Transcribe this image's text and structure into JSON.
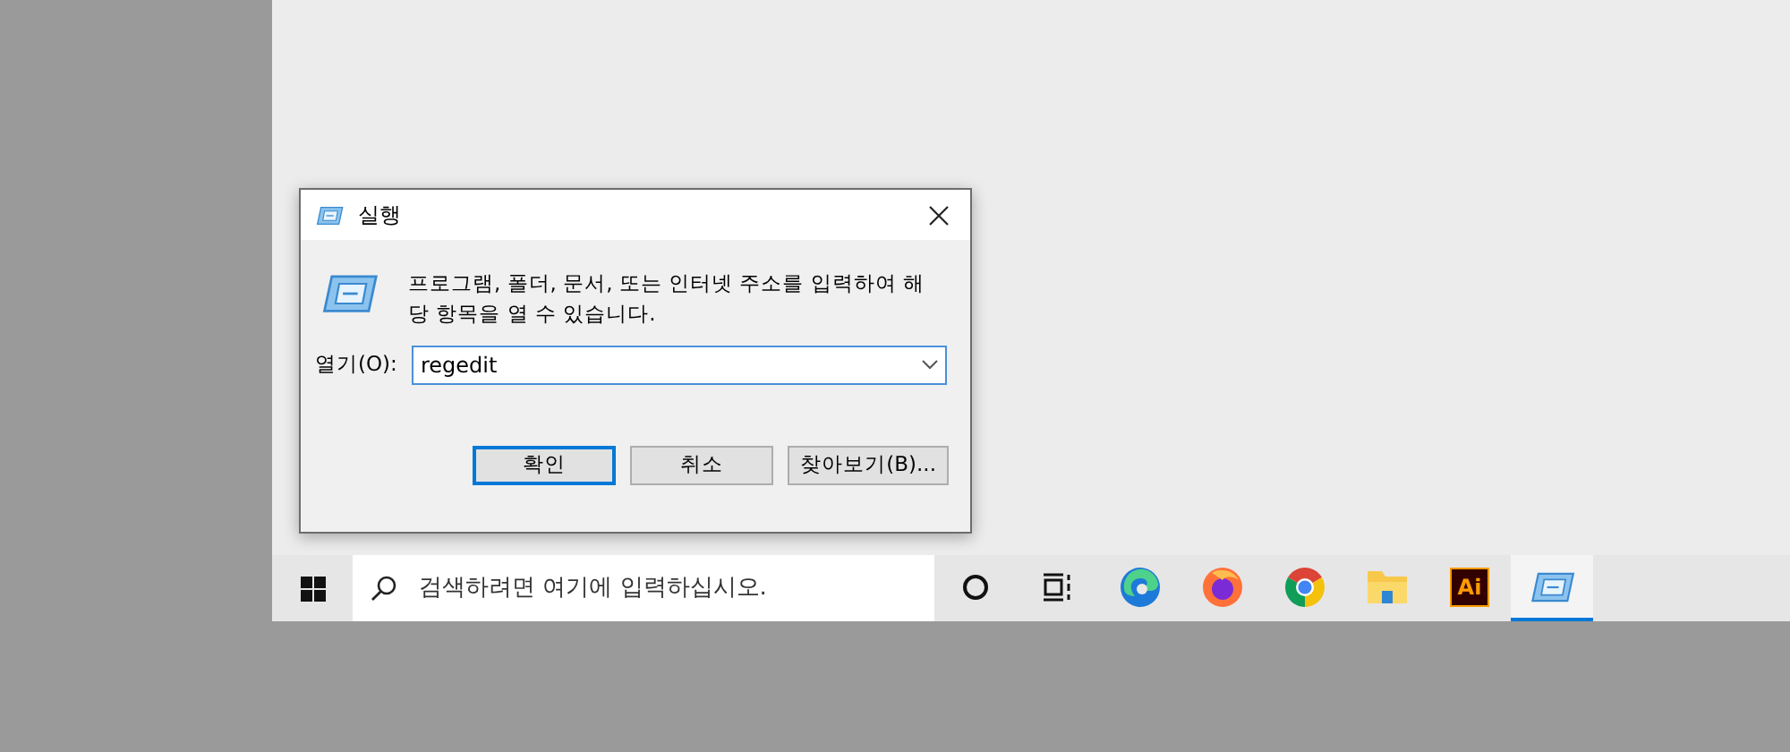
{
  "dialog": {
    "title": "실행",
    "description": "프로그램, 폴더, 문서, 또는 인터넷 주소를 입력하여 해당 항목을 열 수 있습니다.",
    "open_label": "열기(O):",
    "open_value": "regedit",
    "buttons": [
      {
        "label": "확인",
        "selected": true
      },
      {
        "label": "취소",
        "selected": false
      },
      {
        "label": "찾아보기(B)...",
        "selected": false
      }
    ]
  },
  "taskbar": {
    "search_placeholder": "검색하려면 여기에 입력하십시오.",
    "items": [
      {
        "kind": "cortana",
        "selected": false
      },
      {
        "kind": "taskview",
        "selected": false
      },
      {
        "kind": "edge",
        "selected": false
      },
      {
        "kind": "firefox",
        "selected": false
      },
      {
        "kind": "chrome",
        "selected": false
      },
      {
        "kind": "explorer",
        "selected": false
      },
      {
        "kind": "illustrator",
        "label": "Ai",
        "selected": false
      },
      {
        "kind": "run",
        "selected": true
      }
    ]
  }
}
